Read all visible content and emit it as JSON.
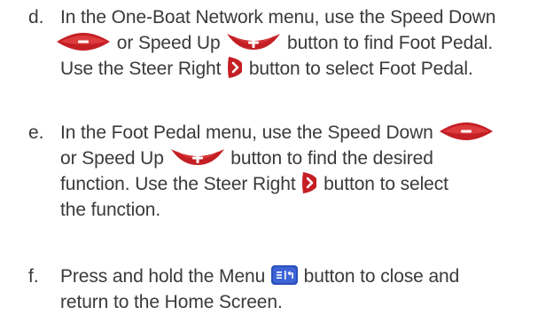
{
  "steps": [
    {
      "marker": "d.",
      "lines": [
        [
          "In the One-Boat Network menu, use the Speed Down",
          ""
        ],
        [
          "",
          " or Speed Up ",
          " button to find Foot Pedal."
        ],
        [
          "Use the Steer Right ",
          " button to select Foot Pedal."
        ]
      ]
    },
    {
      "marker": "e.",
      "lines": [
        [
          "In the Foot Pedal menu, use the Speed Down ",
          ""
        ],
        [
          "or Speed Up ",
          " button to find the desired"
        ],
        [
          "function. Use the Steer Right ",
          " button to select"
        ],
        [
          "the function."
        ]
      ]
    },
    {
      "marker": "f.",
      "lines": [
        [
          "Press and hold the Menu ",
          " button to close and"
        ],
        [
          "return to the Home Screen."
        ]
      ]
    }
  ],
  "icons": {
    "speed_down": "speed-down-button-icon",
    "speed_up": "speed-up-button-icon",
    "steer_right": "steer-right-button-icon",
    "menu": "menu-button-icon"
  },
  "colors": {
    "text": "#3a3a3a",
    "button_red": "#d42a2a",
    "button_dark_red": "#8c1414",
    "menu_blue": "#2b4fb8"
  }
}
